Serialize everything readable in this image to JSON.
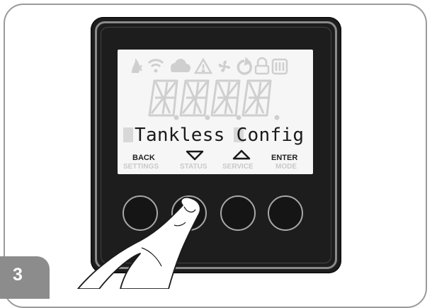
{
  "step": {
    "number": "3"
  },
  "display": {
    "message": "Tankless Config",
    "segment_placeholder": "8.8.8.8."
  },
  "icons": [
    "flame-icon",
    "wifi-icon",
    "cloud-icon",
    "warning-icon",
    "fan-icon",
    "power-icon",
    "lock-icon",
    "heater-icon"
  ],
  "labels": {
    "back": "BACK",
    "settings": "SETTINGS",
    "status": "STATUS",
    "service": "SERVICE",
    "enter": "ENTER",
    "mode": "MODE"
  },
  "colors": {
    "device_body": "#1d1d1d",
    "lcd_background": "#f6f6f6",
    "lcd_text": "#1a1a1a",
    "inactive_segment": "#cfcfcf",
    "step_badge": "#8c8c8c"
  }
}
